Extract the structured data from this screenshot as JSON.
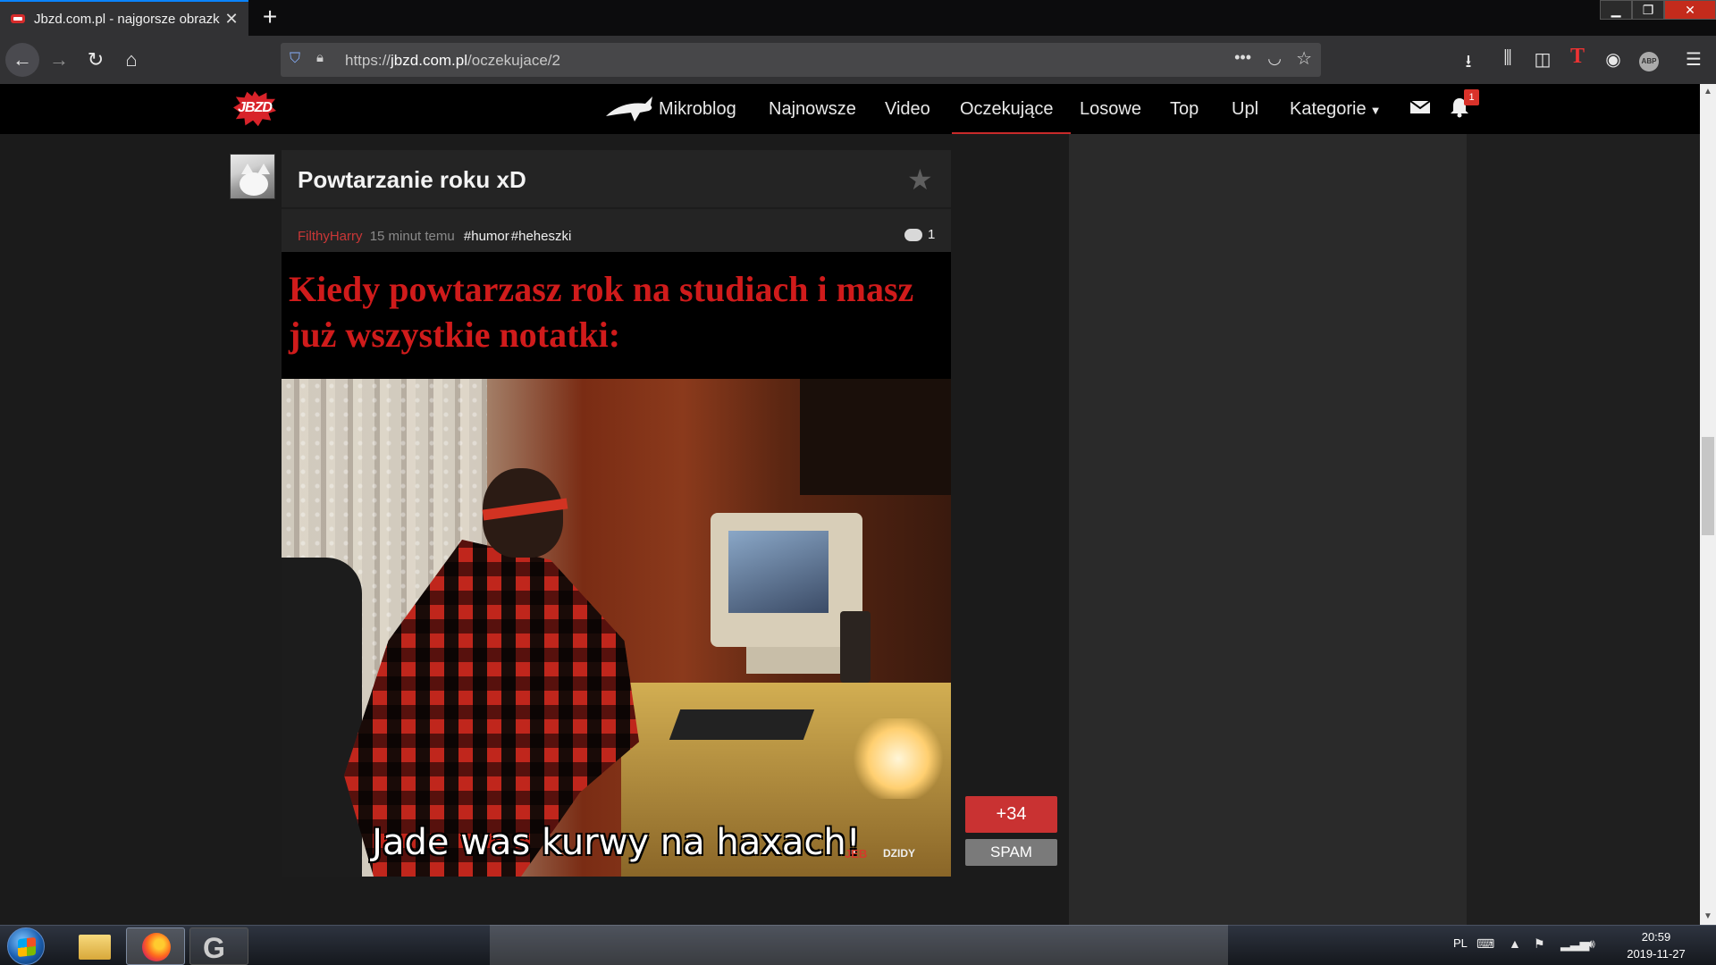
{
  "browser": {
    "tab_title": "Jbzd.com.pl - najgorsze obrazk",
    "tab_close": "✕",
    "new_tab": "+",
    "url_prefix": "https://",
    "url_host": "jbzd.com.pl",
    "url_path": "/oczekujace/2",
    "window_min": "▁",
    "window_max": "❐",
    "window_close": "✕"
  },
  "site": {
    "logo_text": "JBZD",
    "menu": [
      "Mikroblog",
      "Najnowsze",
      "Video",
      "Oczekujące",
      "Losowe",
      "Top",
      "Upl",
      "Kategorie"
    ],
    "active_menu": "Oczekujące",
    "notification_count": "1"
  },
  "post": {
    "title": "Powtarzanie roku xD",
    "author": "FilthyHarry",
    "time": "15 minut temu",
    "tags": [
      "#humor",
      "#heheszki"
    ],
    "comment_count": "1",
    "meme_caption": "Kiedy powtarzasz rok na studiach i masz już wszystkie notatki:",
    "meme_bottom_text": "Jade was kurwy na haxach!",
    "watermark_left": "JEB",
    "watermark_right": "DZIDY",
    "vote_label": "+34",
    "spam_label": "SPAM"
  },
  "taskbar": {
    "language": "PL",
    "time": "20:59",
    "date": "2019-11-27"
  },
  "colors": {
    "accent_red": "#c93232",
    "tab_highlight": "#0a84ff"
  }
}
